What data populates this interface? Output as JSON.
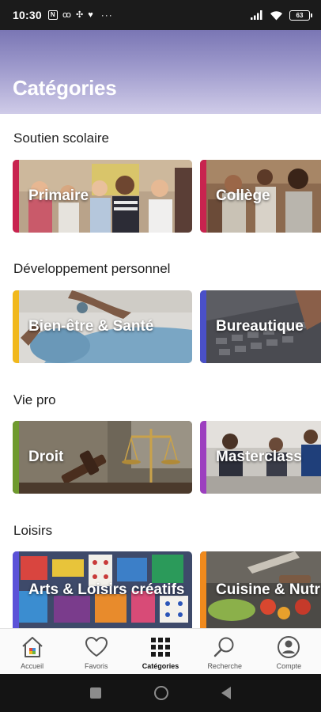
{
  "status_bar": {
    "time": "10:30",
    "notification_icons": [
      "n-icon",
      "voicemail-icon",
      "fan-icon",
      "heart-icon"
    ],
    "overflow": "···",
    "battery": "63"
  },
  "header": {
    "title": "Catégories"
  },
  "sections": [
    {
      "title": "Soutien scolaire",
      "cards": [
        {
          "label": "Primaire",
          "accent": "#c8234f"
        },
        {
          "label": "Collège",
          "accent": "#c8234f"
        }
      ]
    },
    {
      "title": "Développement personnel",
      "cards": [
        {
          "label": "Bien-être & Santé",
          "accent": "#f1b81c"
        },
        {
          "label": "Bureautique",
          "accent": "#4a50c8"
        }
      ]
    },
    {
      "title": "Vie pro",
      "cards": [
        {
          "label": "Droit",
          "accent": "#6f9a2e"
        },
        {
          "label": "Masterclass",
          "accent": "#9c3fbf"
        }
      ]
    },
    {
      "title": "Loisirs",
      "cards": [
        {
          "label": "Arts & Loisirs créatifs",
          "accent": "#5b52d8"
        },
        {
          "label": "Cuisine & Nutr",
          "accent": "#f08a1d"
        }
      ]
    }
  ],
  "bottom_nav": {
    "items": [
      {
        "label": "Accueil",
        "icon": "home-icon"
      },
      {
        "label": "Favoris",
        "icon": "heart-outline-icon"
      },
      {
        "label": "Catégories",
        "icon": "grid-icon",
        "active": true
      },
      {
        "label": "Recherche",
        "icon": "search-icon"
      },
      {
        "label": "Compte",
        "icon": "account-icon"
      }
    ]
  }
}
